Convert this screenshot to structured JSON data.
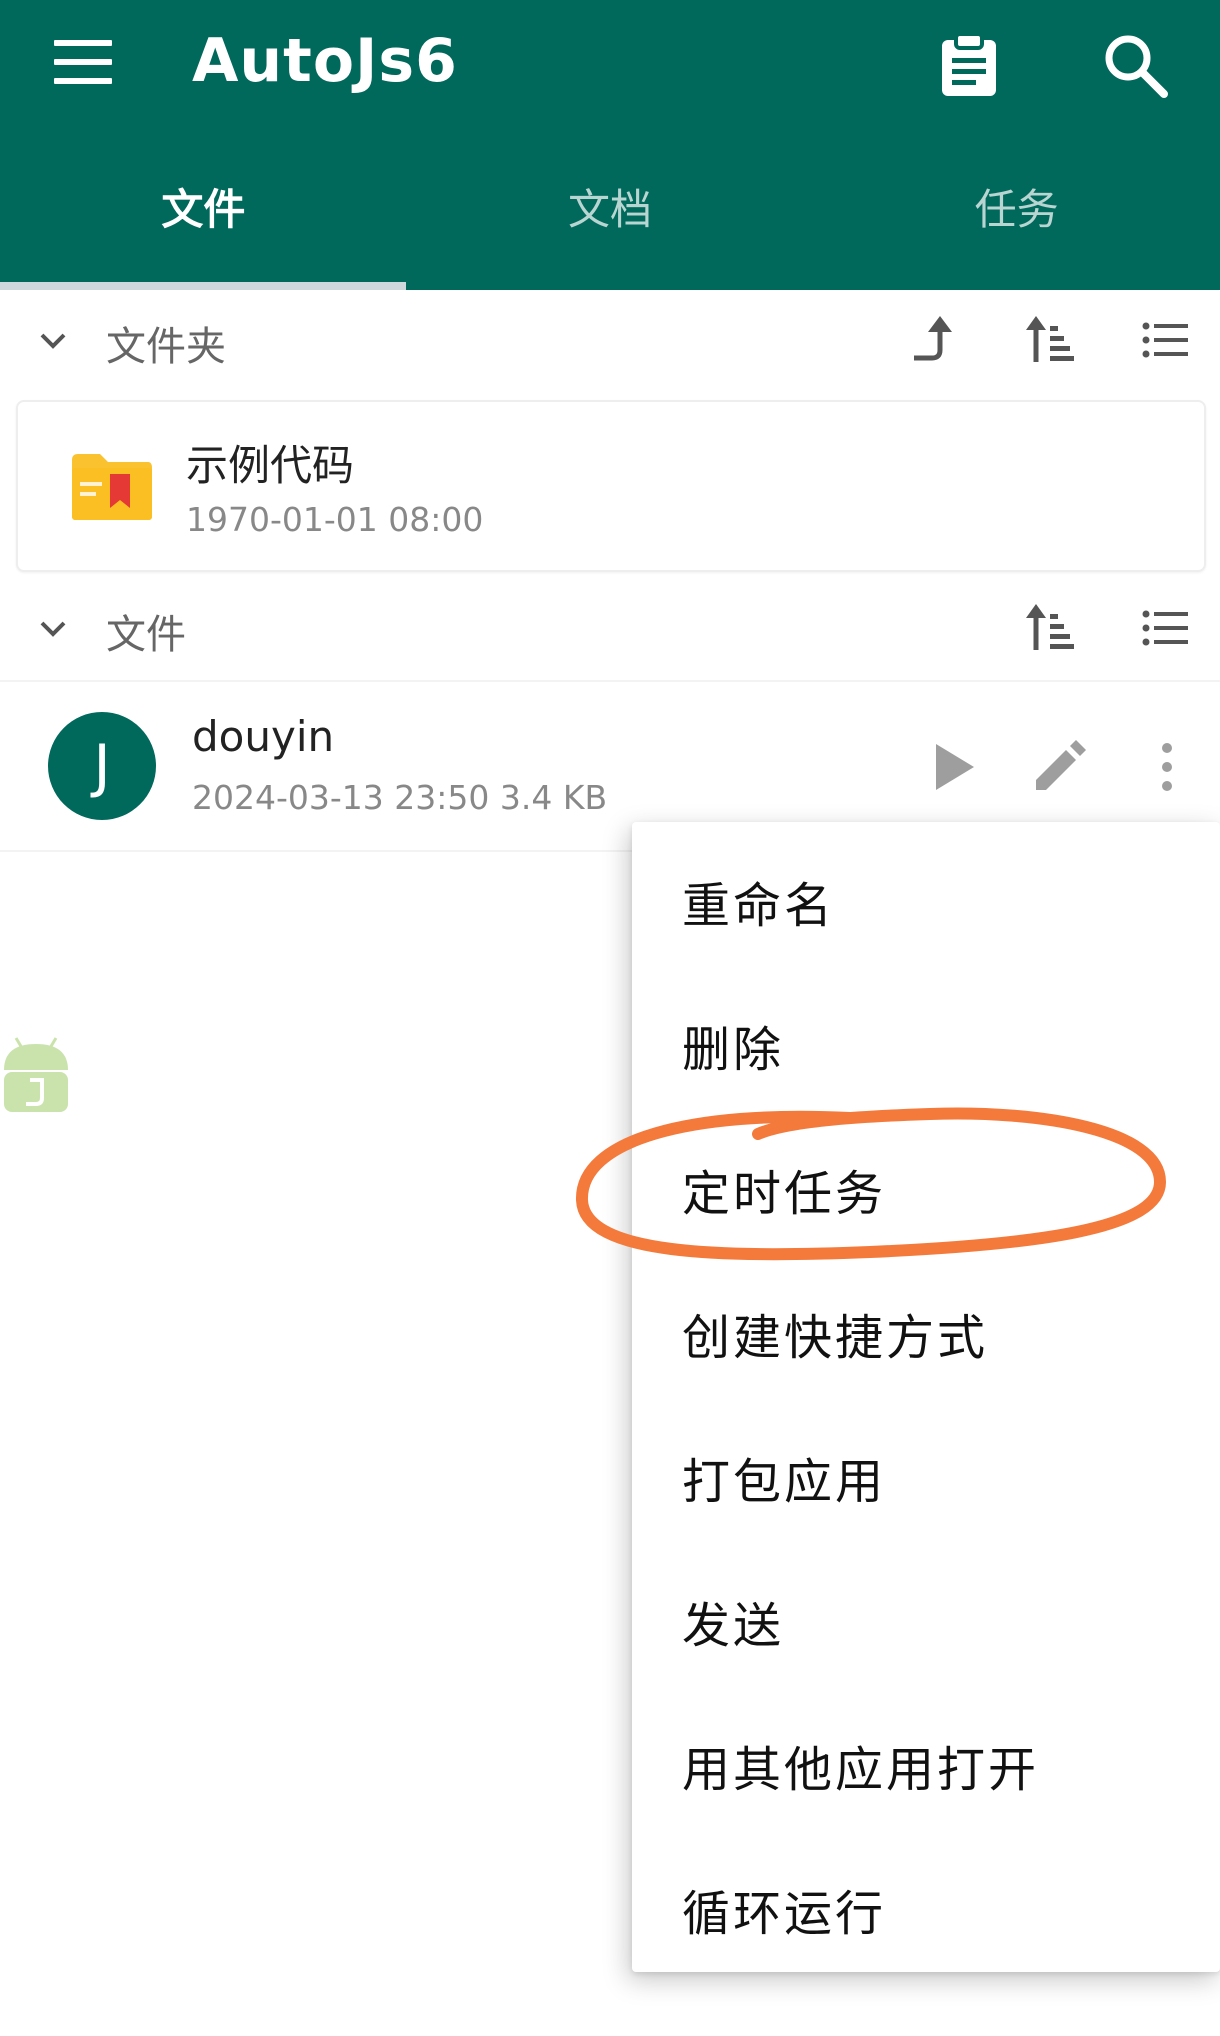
{
  "app": {
    "title": "AutoJs6"
  },
  "tabs": [
    {
      "label": "文件",
      "active": true
    },
    {
      "label": "文档",
      "active": false
    },
    {
      "label": "任务",
      "active": false
    }
  ],
  "folder_section": {
    "label": "文件夹",
    "icons": [
      "up-arrow-icon",
      "sort-icon",
      "list-view-icon"
    ]
  },
  "folder": {
    "name": "示例代码",
    "date": "1970-01-01 08:00",
    "icon": "folder-icon"
  },
  "file_section": {
    "label": "文件",
    "icons": [
      "sort-icon",
      "list-view-icon"
    ]
  },
  "file": {
    "avatar_letter": "J",
    "name": "douyin",
    "meta": "2024-03-13 23:50  3.4 KB",
    "icons": [
      "play-icon",
      "edit-icon",
      "more-vert-icon"
    ]
  },
  "context_menu": {
    "items": [
      {
        "label": "重命名"
      },
      {
        "label": "删除"
      },
      {
        "label": "定时任务",
        "highlighted": true
      },
      {
        "label": "创建快捷方式"
      },
      {
        "label": "打包应用"
      },
      {
        "label": "发送"
      },
      {
        "label": "用其他应用打开"
      },
      {
        "label": "循环运行"
      }
    ]
  },
  "colors": {
    "primary": "#00695c",
    "annotation": "#f47a3c",
    "folder_yellow": "#f9c22e",
    "folder_red": "#e53935"
  }
}
